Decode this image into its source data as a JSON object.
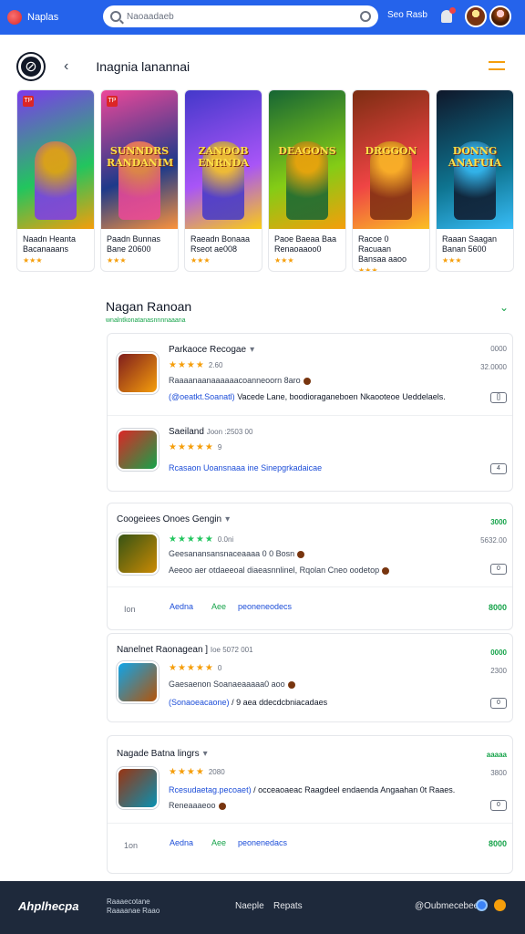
{
  "topbar": {
    "brand": "Naplas",
    "search_value": "Naoaadaeb",
    "nav_text": "Seo  Rasb",
    "accent": "#2563eb"
  },
  "section": {
    "title": "Inagnia lanannai"
  },
  "featured": [
    {
      "art_title": "",
      "name": "Naadn Heanta",
      "sub": "Bacanaaans",
      "stars": "★★★",
      "tag": "TP",
      "colors": [
        "#7c3aed",
        "#22c55e",
        "#f59e0b"
      ]
    },
    {
      "art_title": "SUNNDRS RANDANIM",
      "name": "Paadn Bunnas",
      "sub": "Bane 20600",
      "stars": "★★★",
      "tag": "TP",
      "colors": [
        "#ec4899",
        "#1e3a8a",
        "#fb923c"
      ]
    },
    {
      "art_title": "ZANOOB ENRNDA",
      "name": "Raeadn Bonaaa",
      "sub": "Rseot ae008",
      "stars": "★★★",
      "tag": "",
      "colors": [
        "#4338ca",
        "#a855f7",
        "#facc15"
      ]
    },
    {
      "art_title": "DEAGONS",
      "name": "Paoe Baeaa Baa",
      "sub": "Renaoaaoo0",
      "stars": "★★★",
      "tag": "",
      "colors": [
        "#166534",
        "#84cc16",
        "#f59e0b"
      ]
    },
    {
      "art_title": "DRGGON",
      "name": "Racoe 0 Racuaan",
      "sub": "Bansaa aaoo",
      "stars": "★★★",
      "tag": "",
      "colors": [
        "#7c2d12",
        "#ef4444",
        "#fbbf24"
      ]
    },
    {
      "art_title": "DONNG ANAFUIA",
      "name": "Raaan Saagan",
      "sub": "Banan 5600",
      "stars": "★★★",
      "tag": "",
      "colors": [
        "#0f172a",
        "#0e7490",
        "#38bdf8"
      ]
    }
  ],
  "category": {
    "title": "Nagan Ranoan",
    "subtitle": "wnalntkonatanasnnnnaaana"
  },
  "panel1": {
    "items": [
      {
        "title": "Parkaoce Recogae",
        "stars": "★★★★",
        "rating_text": "2.60",
        "desc": "Raaaanaanaaaaaacoanneoorn 8aro",
        "link": "(@oeatkt.Soanatl)",
        "link_plain": "Vacede Lane, boodioraganeboen Nkaooteoe Ueddelaels.",
        "rt1": "0000",
        "rt2": "32.0000",
        "btn": "[]",
        "colors": [
          "#7f1d1d",
          "#f59e0b"
        ]
      },
      {
        "title": "Saeiland",
        "title_extra": "Joon  :2503 00",
        "stars": "★★★★★",
        "rating_text": "9",
        "desc": "",
        "link": "Rcasaon Uoansnaaa ine Sinepgrkadaicae",
        "link_plain": "",
        "rt1": "",
        "rt2": "",
        "btn": "4",
        "colors": [
          "#dc2626",
          "#16a34a"
        ]
      }
    ]
  },
  "panel2": {
    "item": {
      "title": "Coogeiees Onoes Gengin",
      "stars": "★★★★★",
      "rating_text": "0.0ni",
      "desc": "Geesanansansnaceaaaa 0 0 Bosn",
      "link_plain": "Aeeoo aer otdaeeoal diaeasnnlinel, Rqolan Cneo oodetop",
      "rt1": "3000",
      "rt2": "5632.00",
      "btn": "0",
      "colors": [
        "#365314",
        "#ca8a04"
      ]
    },
    "actions": {
      "left": "Ion",
      "like": "Aedna",
      "share": "Aee",
      "open": "peoneneodecs",
      "right": "8000"
    }
  },
  "panel3": {
    "item": {
      "title": "Nanelnet Raonagean  ]",
      "title_extra": "Ioe  5072 001",
      "stars": "★★★★★",
      "rating_text": "0",
      "desc": "Gaesaenon Soanaeaaaaa0 aoo",
      "link": "(Sonaoeacaone)",
      "link_plain": "/ 9 aea ddecdcbniacadaes",
      "rt1": "0000",
      "rt2": "2300",
      "btn": "0",
      "colors": [
        "#0ea5e9",
        "#b45309"
      ]
    }
  },
  "panel4": {
    "item": {
      "title": "Nagade Batna lingrs",
      "stars": "★★★★",
      "rating_text": "2080",
      "desc": "Reneaaaeoo",
      "link": "Rcesudaetag.pecoaet)",
      "link_plain": "/ occeaoaeac Raagdeel endaenda Angaahan 0t Raaes.",
      "rt1": "aaaaa",
      "rt2": "3800",
      "btn": "0",
      "colors": [
        "#9a3412",
        "#0891b2"
      ]
    },
    "actions": {
      "left": "1on",
      "like": "Aedna",
      "share": "Aee",
      "open": "peonenedacs",
      "right": "8000"
    }
  },
  "footer": {
    "brand": "Ahplhecpa",
    "tag_line1": "Raaaecotane",
    "tag_line2": "Raaaanae  Raao",
    "link1": "Naeple",
    "link2": "Repats",
    "contact": "@Oubmecebee"
  }
}
